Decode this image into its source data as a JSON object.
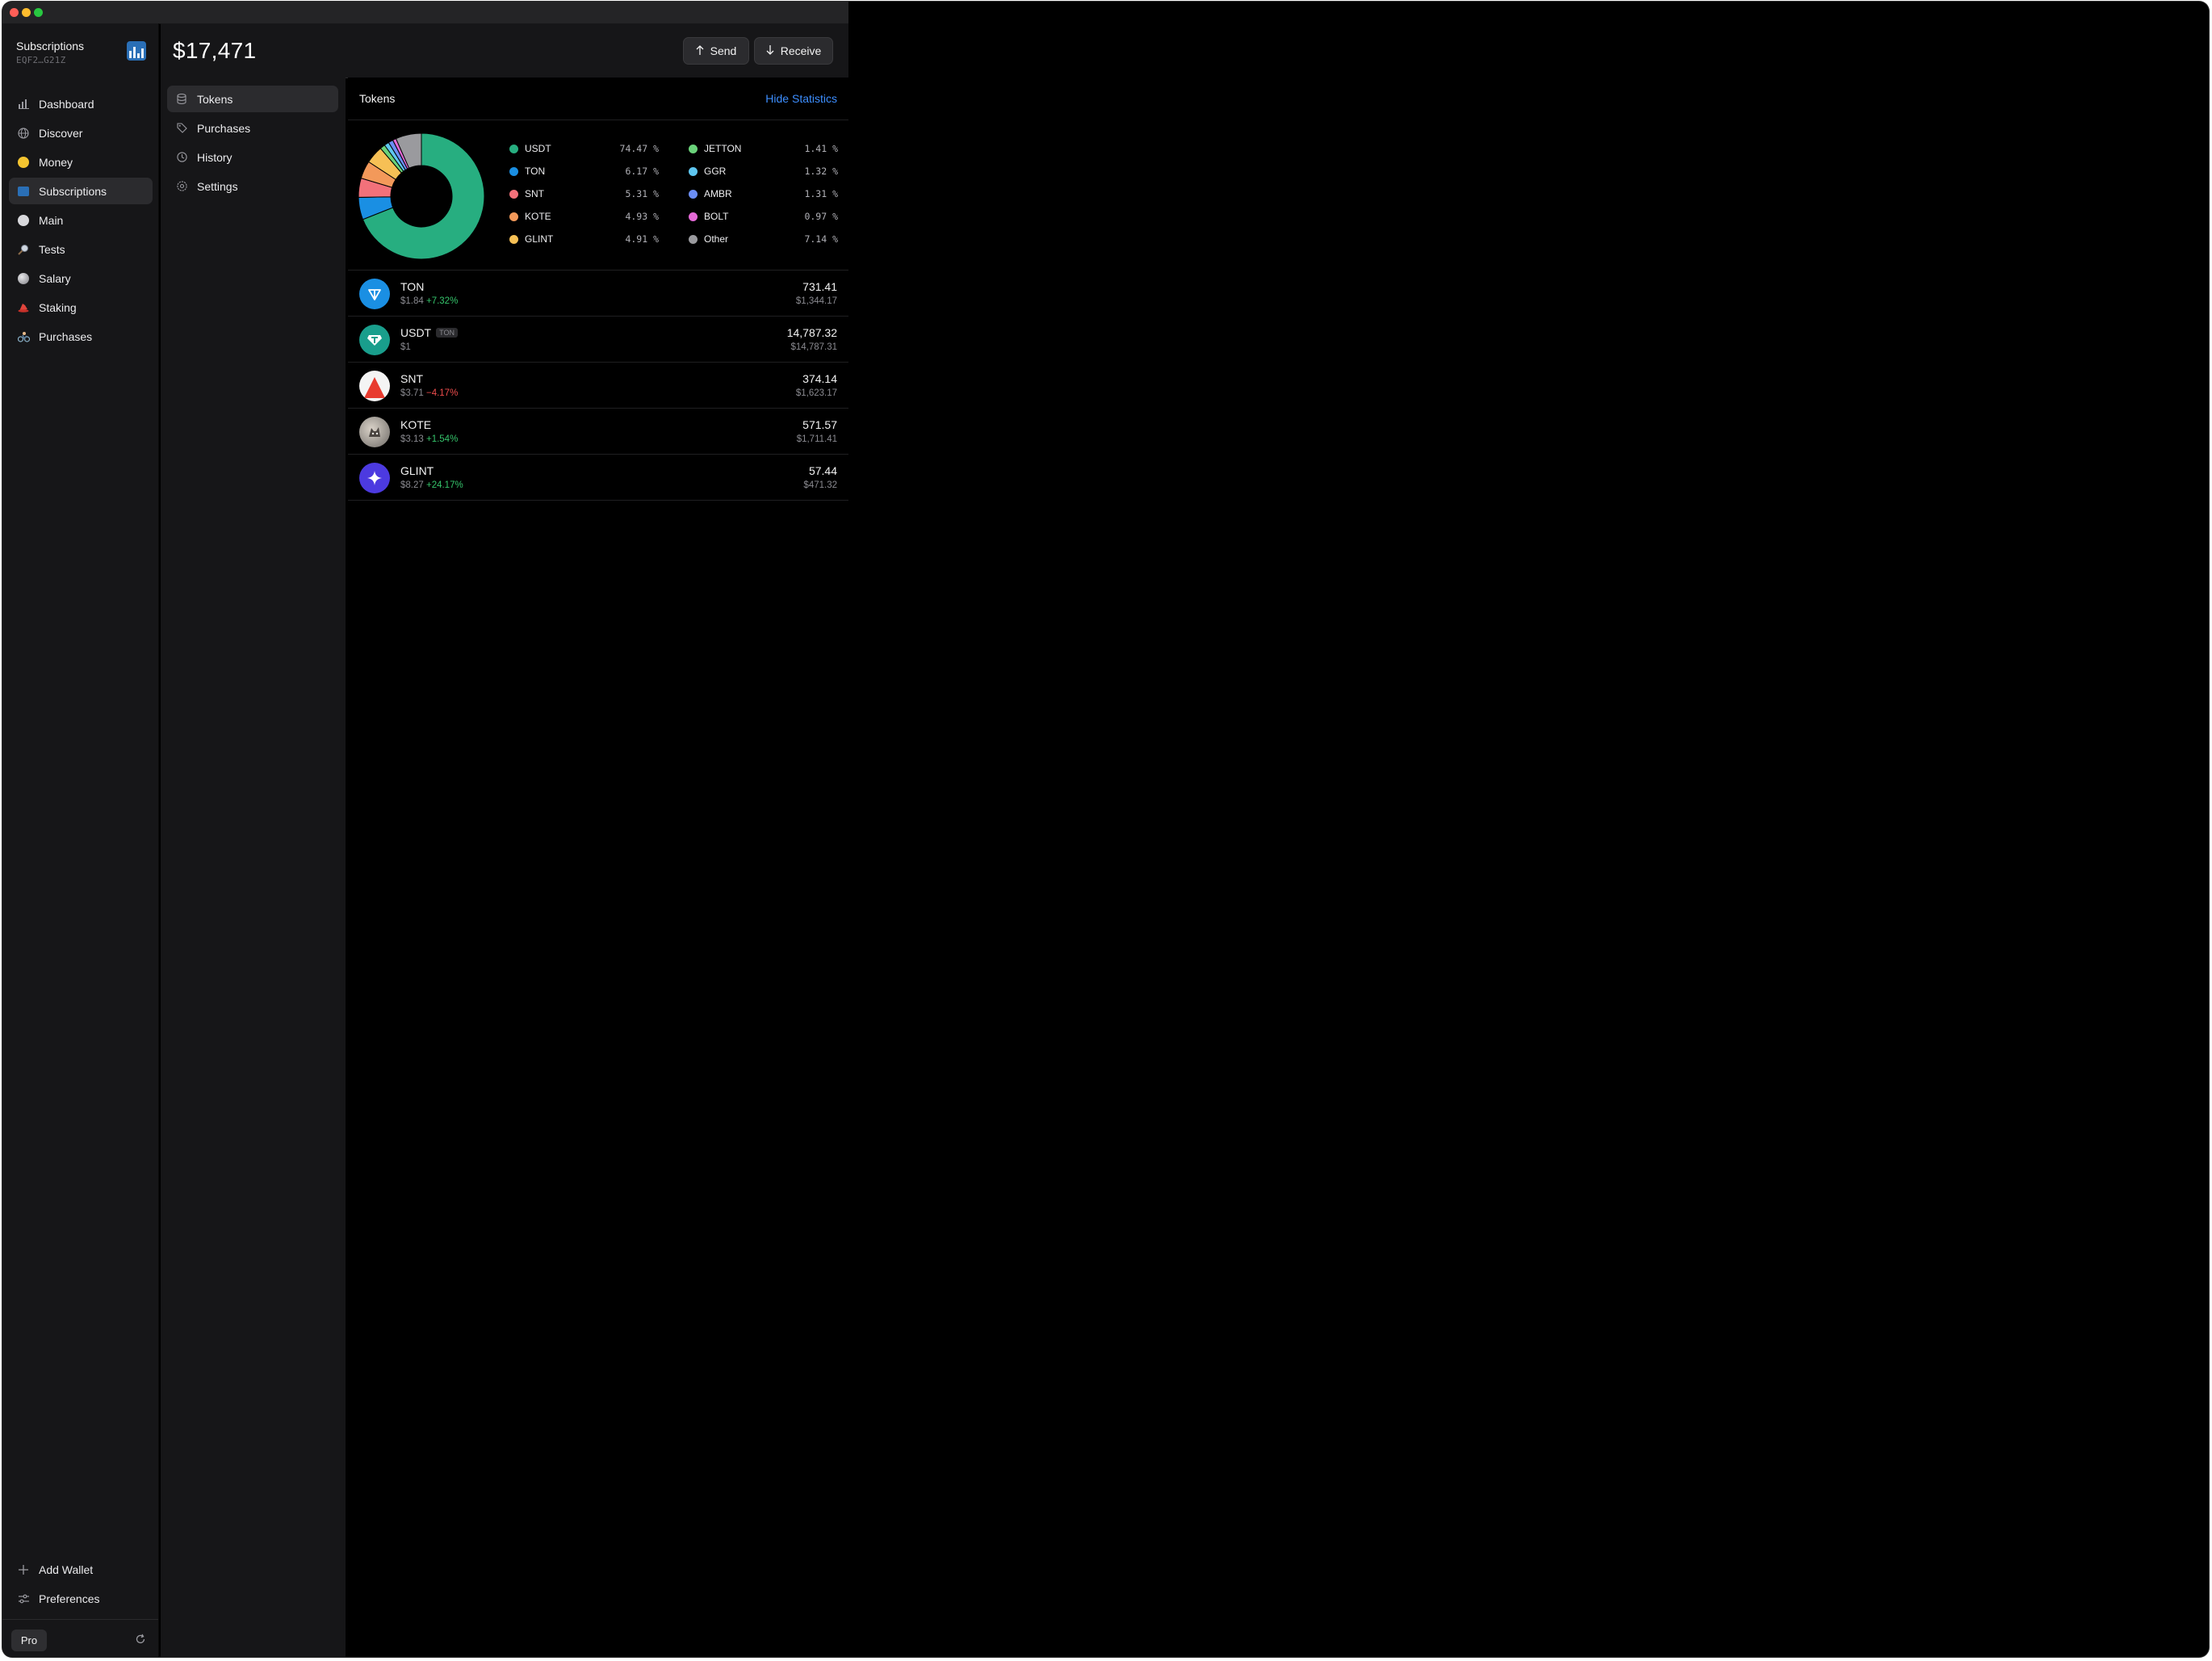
{
  "window": {
    "traffic_lights": [
      "close",
      "minimize",
      "zoom"
    ]
  },
  "wallet": {
    "name": "Subscriptions",
    "address": "EQF2…G21Z",
    "icon": "bar-chart-icon"
  },
  "sidebar": {
    "items": [
      {
        "label": "Dashboard",
        "icon": "bar-chart-icon"
      },
      {
        "label": "Discover",
        "icon": "globe-icon"
      },
      {
        "label": "Money",
        "icon": "money-emoji-icon"
      },
      {
        "label": "Subscriptions",
        "icon": "chart-emoji-icon",
        "active": true
      },
      {
        "label": "Main",
        "icon": "ton-emoji-icon"
      },
      {
        "label": "Tests",
        "icon": "magnifier-emoji-icon"
      },
      {
        "label": "Salary",
        "icon": "moon-emoji-icon"
      },
      {
        "label": "Staking",
        "icon": "hat-emoji-icon"
      },
      {
        "label": "Purchases",
        "icon": "bike-emoji-icon"
      }
    ],
    "bottom": [
      {
        "label": "Add Wallet",
        "icon": "plus-icon"
      },
      {
        "label": "Preferences",
        "icon": "sliders-icon"
      }
    ],
    "pro_label": "Pro"
  },
  "header": {
    "balance": "$17,471",
    "send_label": "Send",
    "receive_label": "Receive"
  },
  "subnav": {
    "items": [
      {
        "label": "Tokens",
        "icon": "database-icon",
        "active": true
      },
      {
        "label": "Purchases",
        "icon": "tag-icon"
      },
      {
        "label": "History",
        "icon": "clock-icon"
      },
      {
        "label": "Settings",
        "icon": "gear-icon"
      }
    ]
  },
  "main": {
    "title": "Tokens",
    "hide_stats_label": "Hide Statistics"
  },
  "chart_data": {
    "type": "pie",
    "donut": true,
    "legend_placement": "right",
    "series": [
      {
        "name": "USDT",
        "value": 74.47,
        "label": "74.47 %",
        "color": "#27ae80"
      },
      {
        "name": "TON",
        "value": 6.17,
        "label": "6.17 %",
        "color": "#1a8fe3"
      },
      {
        "name": "SNT",
        "value": 5.31,
        "label": "5.31 %",
        "color": "#f2717a"
      },
      {
        "name": "KOTE",
        "value": 4.93,
        "label": "4.93 %",
        "color": "#f3995a"
      },
      {
        "name": "GLINT",
        "value": 4.91,
        "label": "4.91 %",
        "color": "#f6c055"
      },
      {
        "name": "JETTON",
        "value": 1.41,
        "label": "1.41 %",
        "color": "#6ad27a"
      },
      {
        "name": "GGR",
        "value": 1.32,
        "label": "1.32 %",
        "color": "#5ec6f0"
      },
      {
        "name": "AMBR",
        "value": 1.31,
        "label": "1.31 %",
        "color": "#6b8ef5"
      },
      {
        "name": "BOLT",
        "value": 0.97,
        "label": "0.97 %",
        "color": "#e469d6"
      },
      {
        "name": "Other",
        "value": 7.14,
        "label": "7.14 %",
        "color": "#9a9a9e"
      }
    ]
  },
  "tokens": [
    {
      "name": "TON",
      "tag": "",
      "price": "$1.84",
      "change": "+7.32%",
      "direction": "up",
      "amount": "731.41",
      "fiat": "$1,344.17",
      "icon": "ton-icon",
      "color": "#1a8fe3"
    },
    {
      "name": "USDT",
      "tag": "TON",
      "price": "$1",
      "change": "",
      "direction": "",
      "amount": "14,787.32",
      "fiat": "$14,787.31",
      "icon": "tether-icon",
      "color": "#199e8c"
    },
    {
      "name": "SNT",
      "tag": "",
      "price": "$3.71",
      "change": "−4.17%",
      "direction": "down",
      "amount": "374.14",
      "fiat": "$1,623.17",
      "icon": "snt-icon",
      "color": "#ffffff"
    },
    {
      "name": "KOTE",
      "tag": "",
      "price": "$3.13",
      "change": "+1.54%",
      "direction": "up",
      "amount": "571.57",
      "fiat": "$1,711.41",
      "icon": "kote-icon",
      "color": "#8e8a86"
    },
    {
      "name": "GLINT",
      "tag": "",
      "price": "$8.27",
      "change": "+24.17%",
      "direction": "up",
      "amount": "57.44",
      "fiat": "$471.32",
      "icon": "sparkle-icon",
      "color": "#4c3ae0"
    }
  ]
}
